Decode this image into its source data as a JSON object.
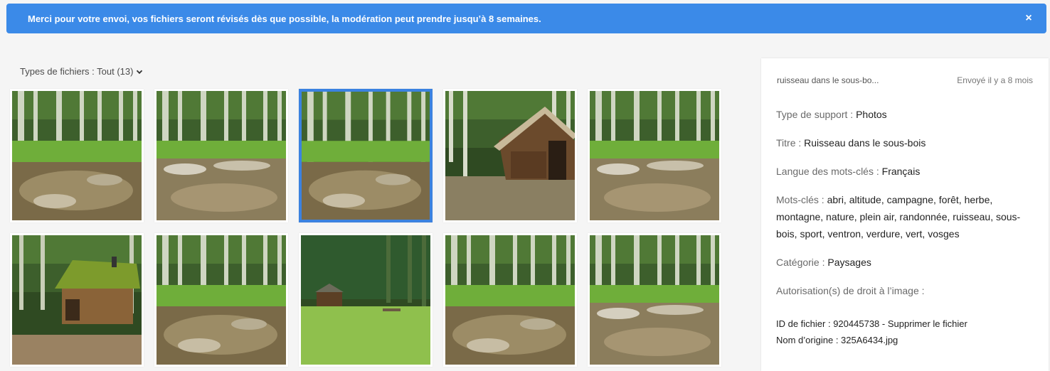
{
  "banner": {
    "message": "Merci pour votre envoi, vos fichiers seront révisés dès que possible, la modération peut prendre jusqu’à 8 semaines.",
    "close_glyph": "×"
  },
  "filter": {
    "label": "Types de fichiers : Tout (13)"
  },
  "thumbnails": [
    {
      "scene": "forest-stream"
    },
    {
      "scene": "stream-pebbles"
    },
    {
      "scene": "stream-wide",
      "selected": true
    },
    {
      "scene": "wooden-hut"
    },
    {
      "scene": "stream-pebbles"
    },
    {
      "scene": "mossy-cabin"
    },
    {
      "scene": "forest-stream"
    },
    {
      "scene": "clearing-hut"
    },
    {
      "scene": "forest-stream"
    },
    {
      "scene": "stream-pebbles"
    }
  ],
  "panel": {
    "file_short_name": "ruisseau dans le sous-bo...",
    "sent": "Envoyé il y a 8 mois",
    "support_label": "Type de support : ",
    "support_value": "Photos",
    "title_label": "Titre : ",
    "title_value": "Ruisseau dans le sous-bois",
    "lang_label": "Langue des mots-clés : ",
    "lang_value": "Français",
    "keywords_label": "Mots-clés : ",
    "keywords_value": "abri, altitude, campagne, forêt, herbe, montagne, nature, plein air, randonnée, ruisseau, sous-bois, sport, ventron, verdure, vert, vosges",
    "category_label": "Catégorie : ",
    "category_value": "Paysages",
    "rights_label": "Autorisation(s) de droit à l’image :",
    "file_id_label": "ID de fichier : ",
    "file_id_value": "920445738",
    "separator": " - ",
    "delete_label": "Supprimer le fichier",
    "origin_label": "Nom d’origine : ",
    "origin_value": "325A6434.jpg"
  }
}
